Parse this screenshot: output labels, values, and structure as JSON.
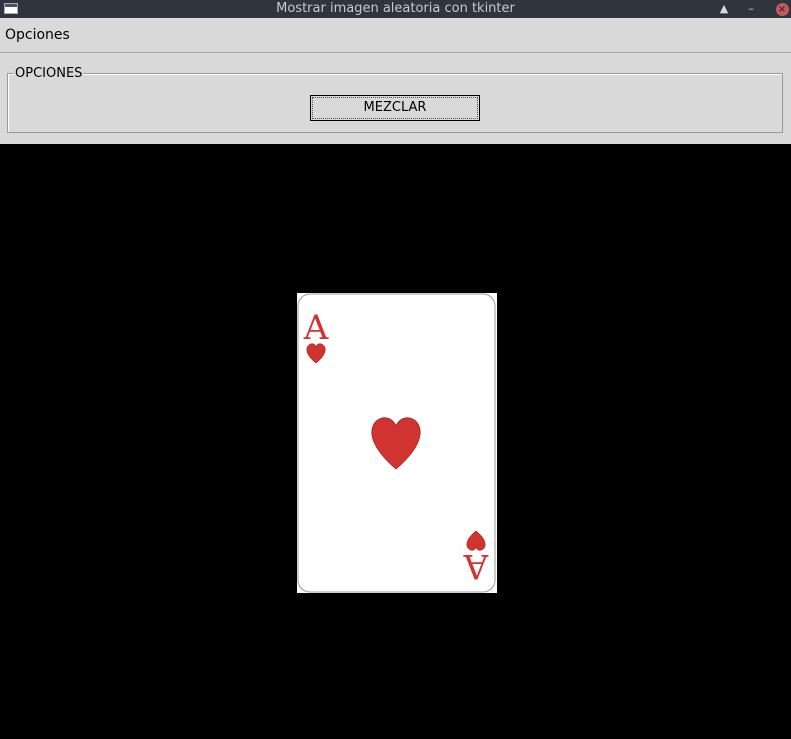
{
  "window": {
    "title": "Mostrar imagen aleatoria con tkinter"
  },
  "titlebar_icons": {
    "app": "window-icon",
    "maximize": "maximize-icon",
    "minimize": "minimize-icon",
    "close": "close-icon"
  },
  "menubar": {
    "items": [
      {
        "label": "Opciones"
      }
    ]
  },
  "options_frame": {
    "legend": "OPCIONES",
    "button_label": "MEZCLAR"
  },
  "card": {
    "rank": "A",
    "suit": "hearts",
    "suit_color": "#cf3431"
  },
  "colors": {
    "titlebar_bg": "#2f343f",
    "panel_bg": "#d9d9d9",
    "canvas_bg": "#000000",
    "close_button": "#cc575d"
  }
}
